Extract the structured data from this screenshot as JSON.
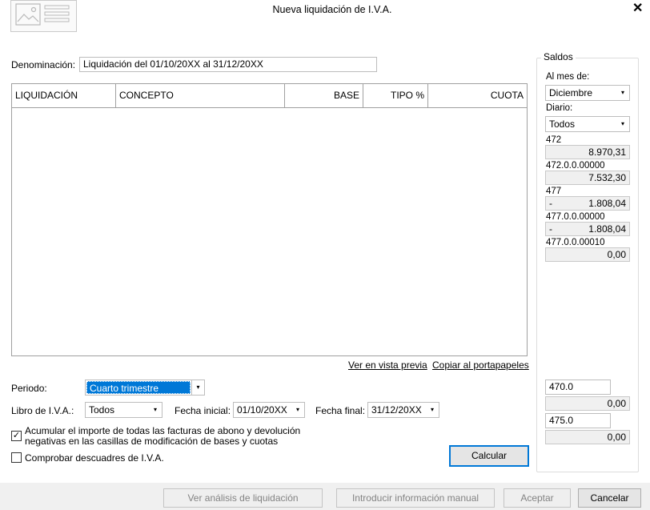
{
  "window": {
    "title": "Nueva liquidación de I.V.A.",
    "close_glyph": "✕"
  },
  "denominacion": {
    "label": "Denominación:",
    "value": "Liquidación del 01/10/20XX al 31/12/20XX"
  },
  "grid": {
    "columns": [
      "LIQUIDACIÓN",
      "CONCEPTO",
      "BASE",
      "TIPO %",
      "CUOTA"
    ],
    "rows": []
  },
  "links": {
    "vista_previa": "Ver en vista previa",
    "portapapeles": "Copiar al portapapeles"
  },
  "periodo": {
    "label": "Periodo:",
    "value": "Cuarto trimestre"
  },
  "libro": {
    "label": "Libro de I.V.A.:",
    "value": "Todos"
  },
  "fecha_inicial": {
    "label": "Fecha inicial:",
    "value": "01/10/20XX"
  },
  "fecha_final": {
    "label": "Fecha final:",
    "value": "31/12/20XX"
  },
  "acumular": {
    "checked": true,
    "mark": "✓",
    "line1": "Acumular el importe de todas las facturas de abono y devolución",
    "line2": "negativas en las casillas de modificación de bases y cuotas"
  },
  "comprobar": {
    "checked": false,
    "label": "Comprobar descuadres de I.V.A."
  },
  "calcular_label": "Calcular",
  "saldos": {
    "title": "Saldos",
    "al_mes_label": "Al mes de:",
    "al_mes_value": "Diciembre",
    "diario_label": "Diario:",
    "diario_value": "Todos",
    "accounts": [
      {
        "name": "472",
        "prefix": "",
        "value": "8.970,31"
      },
      {
        "name": "472.0.0.00000",
        "prefix": "",
        "value": "7.532,30"
      },
      {
        "name": "477",
        "prefix": "-",
        "value": "1.808,04"
      },
      {
        "name": "477.0.0.00000",
        "prefix": "-",
        "value": "1.808,04"
      },
      {
        "name": "477.0.0.00010",
        "prefix": "",
        "value": "0,00"
      }
    ],
    "bottom": [
      {
        "account": "470.0",
        "value": "0,00"
      },
      {
        "account": "475.0",
        "value": "0,00"
      }
    ]
  },
  "footer": {
    "analisis": "Ver análisis de liquidación",
    "manual": "Introducir información manual",
    "aceptar": "Aceptar",
    "cancelar": "Cancelar"
  },
  "icons": {
    "dropdown": "▾",
    "logo": "document-image-icon"
  }
}
